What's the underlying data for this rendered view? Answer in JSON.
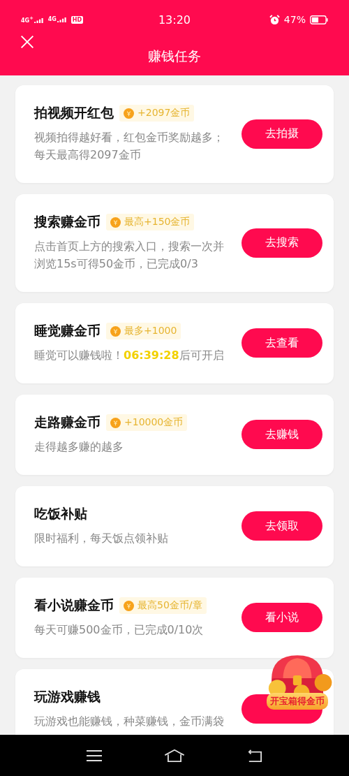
{
  "status_bar": {
    "networks": [
      "4G$^{+}$",
      "4G"
    ],
    "hd": "HD",
    "time": "13:20",
    "battery": "47%"
  },
  "header": {
    "title": "赚钱任务"
  },
  "tasks": [
    {
      "title": "拍视频开红包",
      "reward": "+2097金币",
      "desc": [
        {
          "text": "视频拍得越好看，红包金币奖励越多；每天最高得2097金币",
          "highlight": false
        }
      ],
      "button": "去拍摄"
    },
    {
      "title": "搜索赚金币",
      "reward": "最高+150金币",
      "desc": [
        {
          "text": "点击首页上方的搜索入口，搜索一次并浏览15s可得50金币，已完成0/3",
          "highlight": false
        }
      ],
      "button": "去搜索"
    },
    {
      "title": "睡觉赚金币",
      "reward": "最多+1000",
      "desc": [
        {
          "text": "睡觉可以赚钱啦！",
          "highlight": false
        },
        {
          "text": "06:39:28",
          "highlight": true
        },
        {
          "text": "后可开启",
          "highlight": false
        }
      ],
      "button": "去查看"
    },
    {
      "title": "走路赚金币",
      "reward": "+10000金币",
      "desc": [
        {
          "text": "走得越多赚的越多",
          "highlight": false
        }
      ],
      "button": "去赚钱"
    },
    {
      "title": "吃饭补贴",
      "desc": [
        {
          "text": "限时福利，每天饭点领补贴",
          "highlight": false
        }
      ],
      "button": "去领取"
    },
    {
      "title": "看小说赚金币",
      "reward": "最高50金币/章",
      "desc": [
        {
          "text": "每天可赚500金币，已完成0/10次",
          "highlight": false
        }
      ],
      "button": "看小说"
    },
    {
      "title": "玩游戏赚钱",
      "desc": [
        {
          "text": "玩游戏也能赚钱，种菜赚钱，金币满袋",
          "highlight": false
        }
      ]
    }
  ],
  "treasure": {
    "label": "开宝箱得金币"
  }
}
